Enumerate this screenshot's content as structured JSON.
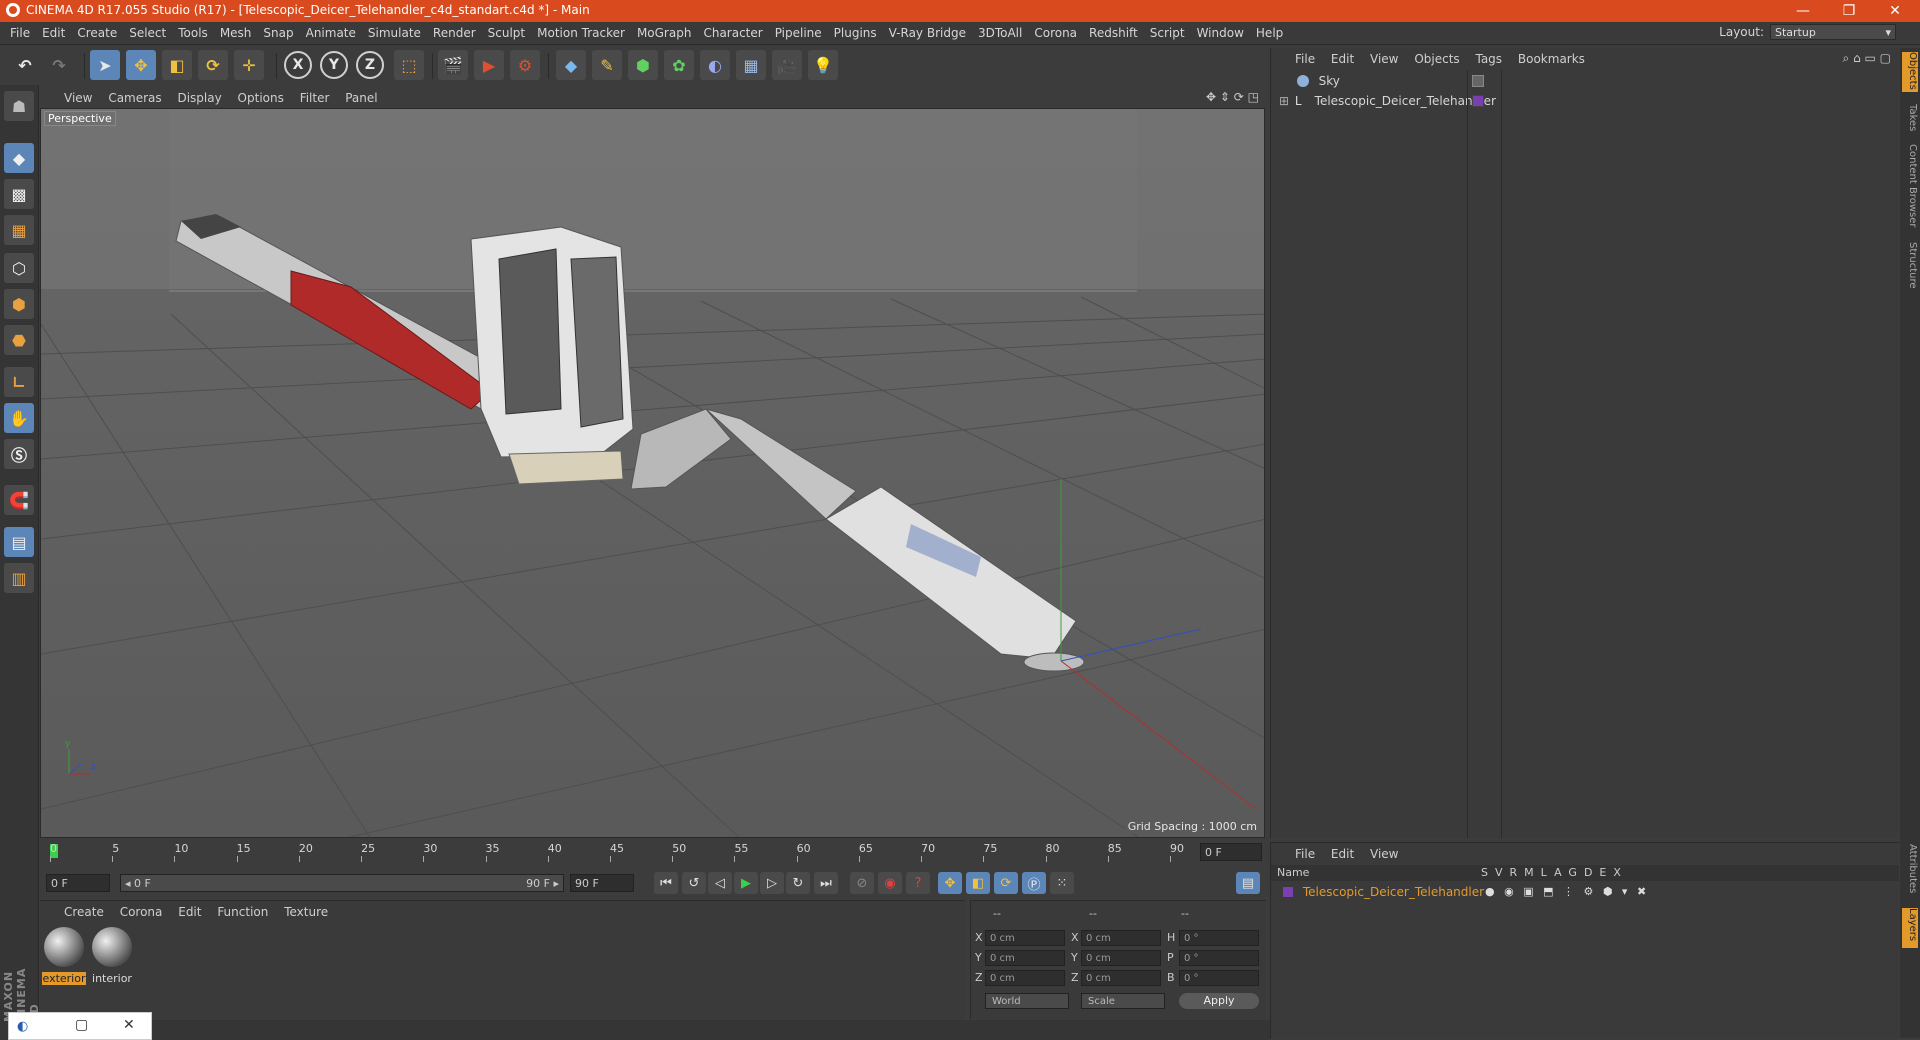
{
  "window": {
    "title": "CINEMA 4D R17.055 Studio (R17) - [Telescopic_Deicer_Telehandler_c4d_standart.c4d *] - Main",
    "controls": [
      "—",
      "❐",
      "✕"
    ]
  },
  "menubar": {
    "items": [
      "File",
      "Edit",
      "Create",
      "Select",
      "Tools",
      "Mesh",
      "Snap",
      "Animate",
      "Simulate",
      "Render",
      "Sculpt",
      "Motion Tracker",
      "MoGraph",
      "Character",
      "Pipeline",
      "Plugins",
      "V-Ray Bridge",
      "3DToAll",
      "Corona",
      "Redshift",
      "Script",
      "Window",
      "Help"
    ],
    "layout_label": "Layout:",
    "layout_value": "Startup"
  },
  "toolbar": {
    "icons": [
      "undo-icon",
      "redo-icon",
      "select-arrow-icon",
      "move-icon",
      "scale-icon",
      "rotate-icon",
      "transform-icon",
      "x-axis-icon",
      "y-axis-icon",
      "z-axis-icon",
      "coordinate-system-icon",
      "render-view-icon",
      "render-picture-viewer-icon",
      "edit-render-settings-icon",
      "cube-icon",
      "pen-icon",
      "subdivision-icon",
      "cloner-icon",
      "deformer-icon",
      "floor-icon",
      "camera-icon",
      "light-icon"
    ],
    "axis_labels": [
      "X",
      "Y",
      "Z"
    ]
  },
  "viewport": {
    "menu": [
      "View",
      "Cameras",
      "Display",
      "Options",
      "Filter",
      "Panel"
    ],
    "label": "Perspective",
    "grid_spacing": "Grid Spacing : 1000 cm"
  },
  "object_manager": {
    "menu": [
      "File",
      "Edit",
      "View",
      "Objects",
      "Tags",
      "Bookmarks"
    ],
    "objects": [
      {
        "name": "Sky",
        "icon": "sky-icon"
      },
      {
        "name": "Telescopic_Deicer_Telehandler",
        "icon": "null-object-icon"
      }
    ]
  },
  "side_tabs": [
    "Objects",
    "Takes",
    "Content Browser",
    "Structure"
  ],
  "side_tabs_lower": [
    "Attributes",
    "Layers"
  ],
  "layer_manager": {
    "menu": [
      "File",
      "Edit",
      "View"
    ],
    "header": {
      "name": "Name",
      "columns": [
        "S",
        "V",
        "R",
        "M",
        "L",
        "A",
        "G",
        "D",
        "E",
        "X"
      ]
    },
    "layers": [
      {
        "name": "Telescopic_Deicer_Telehandler",
        "color": "#7a3fb0"
      }
    ]
  },
  "timeline": {
    "ticks": [
      "0",
      "5",
      "10",
      "15",
      "20",
      "25",
      "30",
      "35",
      "40",
      "45",
      "50",
      "55",
      "60",
      "65",
      "70",
      "75",
      "80",
      "85",
      "90"
    ],
    "current_frame": "0 F",
    "start_field": "0 F",
    "range_start": "◂ 0 F",
    "range_end": "90 F ▸",
    "end_field": "90 F"
  },
  "material_manager": {
    "menu": [
      "Create",
      "Corona",
      "Edit",
      "Function",
      "Texture"
    ],
    "materials": [
      {
        "name": "exterior",
        "selected": true
      },
      {
        "name": "interior",
        "selected": false
      }
    ]
  },
  "coordinates": {
    "header": [
      "--",
      "--",
      "--"
    ],
    "rows": [
      {
        "axis": "X",
        "pos": "0 cm",
        "axis2": "X",
        "size": "0 cm",
        "rot_label": "H",
        "rot": "0 °"
      },
      {
        "axis": "Y",
        "pos": "0 cm",
        "axis2": "Y",
        "size": "0 cm",
        "rot_label": "P",
        "rot": "0 °"
      },
      {
        "axis": "Z",
        "pos": "0 cm",
        "axis2": "Z",
        "size": "0 cm",
        "rot_label": "B",
        "rot": "0 °"
      }
    ],
    "mode": "World",
    "size_mode": "Scale",
    "apply": "Apply"
  },
  "branding": "MAXON CINEMA 4D",
  "colors": {
    "title_bar": "#d94a1e",
    "accent": "#e39a2b",
    "active_tool": "#5d86b8",
    "layer_color": "#7a3fb0"
  }
}
